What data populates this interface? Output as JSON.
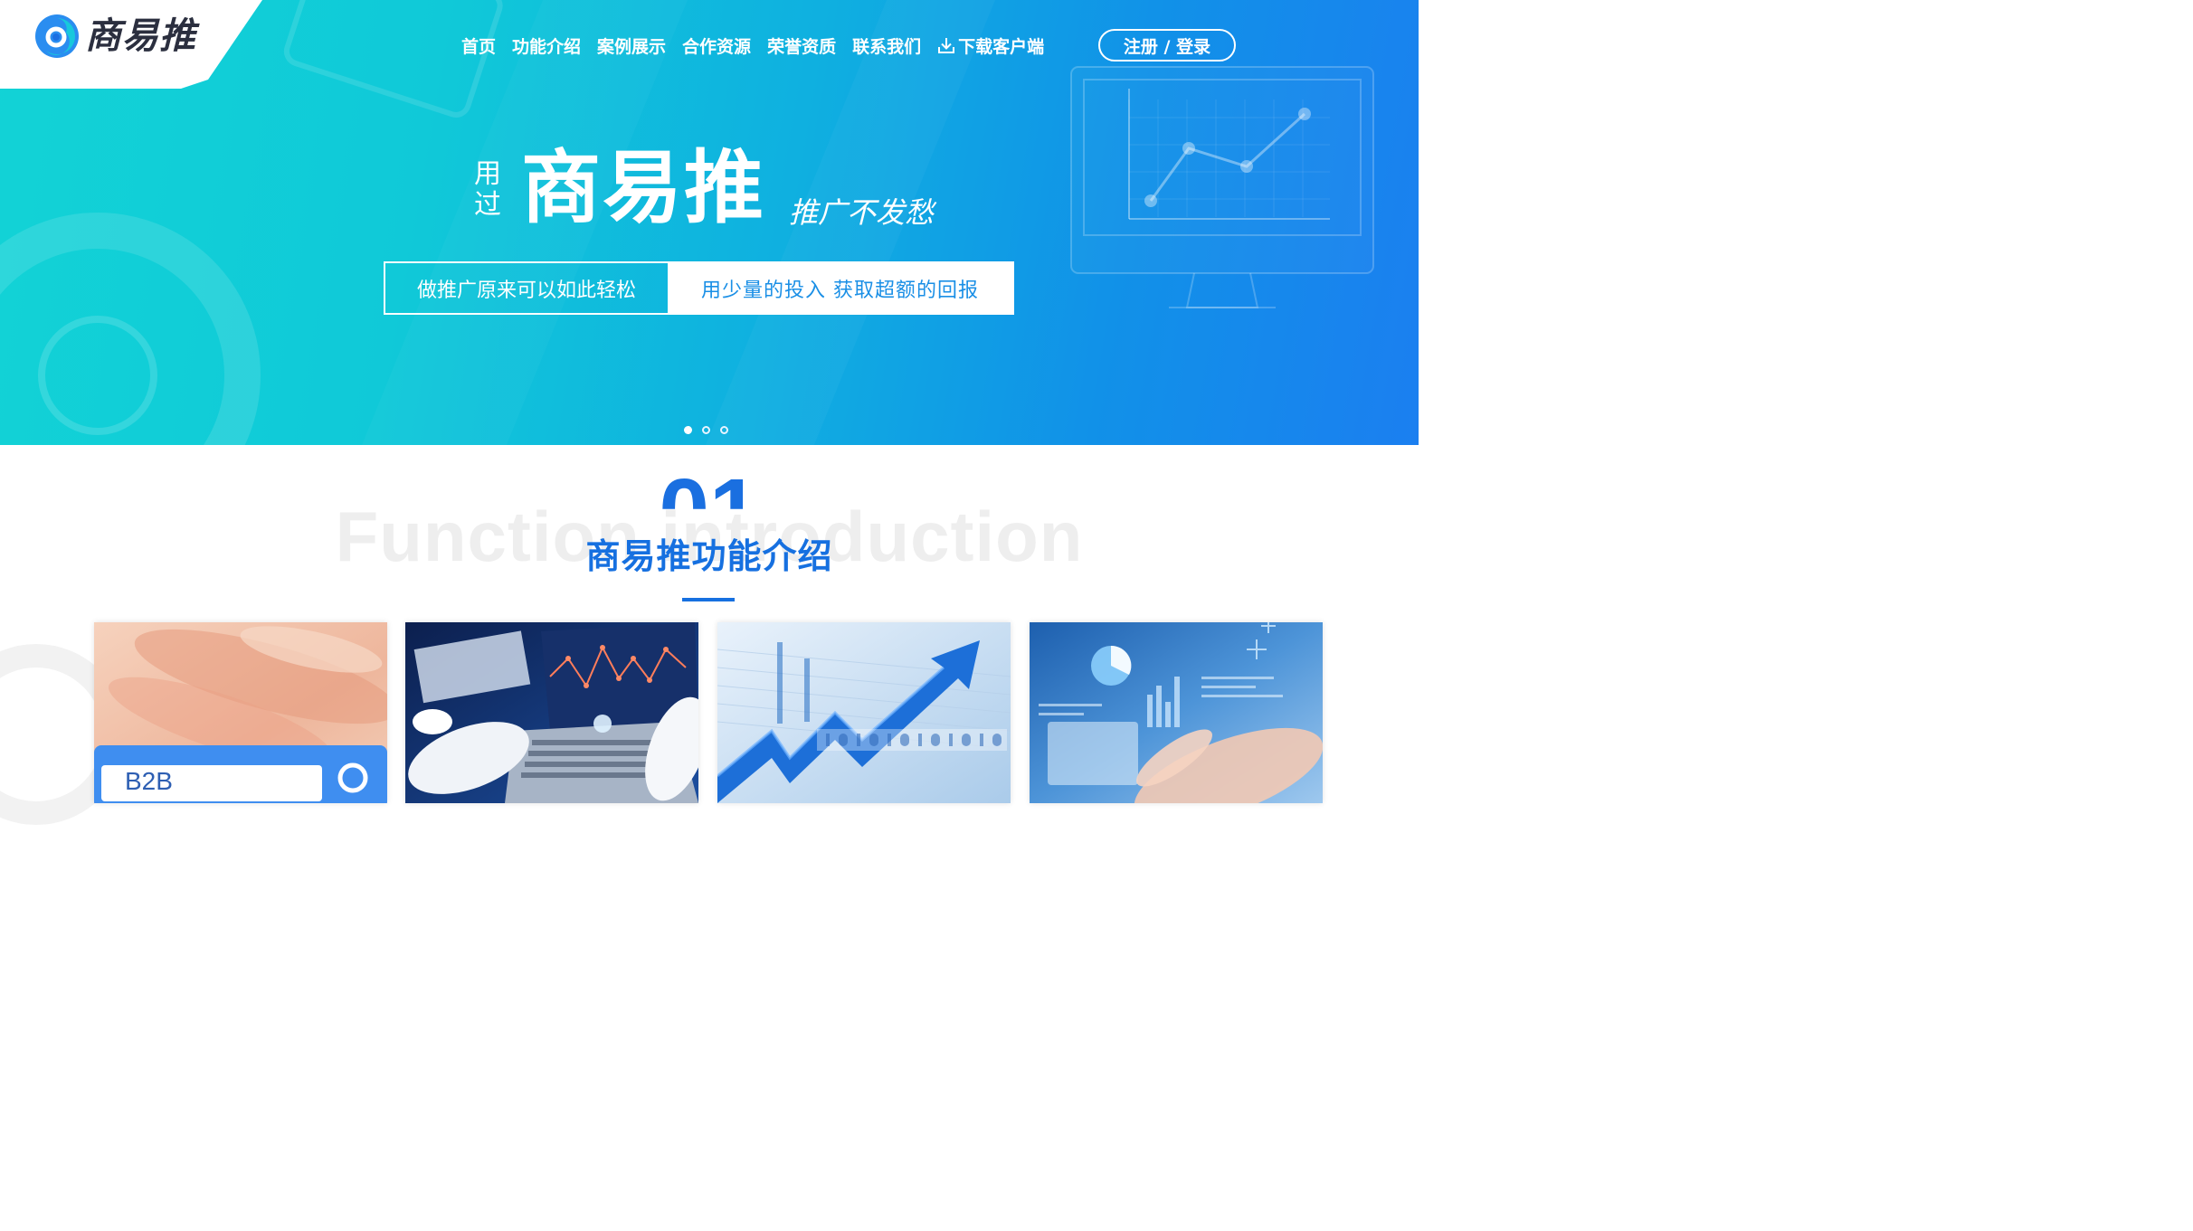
{
  "brand": {
    "name": "商易推"
  },
  "nav": {
    "items": [
      {
        "label": "首页"
      },
      {
        "label": "功能介绍"
      },
      {
        "label": "案例展示"
      },
      {
        "label": "合作资源"
      },
      {
        "label": "荣誉资质"
      },
      {
        "label": "联系我们"
      },
      {
        "label": "下载客户端",
        "icon": "download-icon"
      }
    ],
    "login_label": "注册 / 登录"
  },
  "hero": {
    "prefix": "用过",
    "brand": "商易推",
    "suffix": "推广不发愁",
    "tagline_left": "做推广原来可以如此轻松",
    "tagline_right": "用少量的投入  获取超额的回报",
    "slides": 3,
    "active_slide": 1
  },
  "section": {
    "english_watermark": "Function introduction",
    "number": "01",
    "title": "商易推功能介绍"
  },
  "cards": [
    {
      "label": "B2B"
    },
    {
      "label": ""
    },
    {
      "label": ""
    },
    {
      "label": ""
    }
  ],
  "colors": {
    "accent": "#1670e0",
    "hero_start": "#12d3d6",
    "hero_end": "#1b7ff0"
  }
}
